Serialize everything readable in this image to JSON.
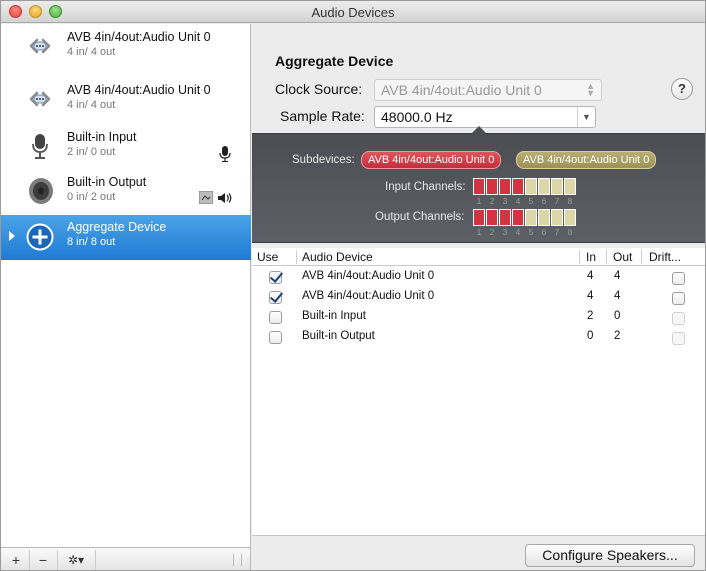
{
  "window": {
    "title": "Audio Devices"
  },
  "sidebar": {
    "devices": [
      {
        "name": "AVB 4in/4out:Audio Unit 0",
        "io": "4 in/ 4 out",
        "icon": "network-icon"
      },
      {
        "name": "AVB 4in/4out:Audio Unit 0",
        "io": "4 in/ 4 out",
        "icon": "network-icon"
      },
      {
        "name": "Built-in Input",
        "io": "2 in/ 0 out",
        "icon": "microphone-icon"
      },
      {
        "name": "Built-in Output",
        "io": "0 in/ 2 out",
        "icon": "speaker-icon"
      },
      {
        "name": "Aggregate Device",
        "io": "8 in/ 8 out",
        "icon": "add-icon",
        "selected": true
      }
    ],
    "footer": {
      "add": "+",
      "remove": "−",
      "gear": "✲▾"
    }
  },
  "detail": {
    "title": "Aggregate Device",
    "clock_source_label": "Clock Source:",
    "clock_source_value": "AVB 4in/4out:Audio Unit 0",
    "sample_rate_label": "Sample Rate:",
    "sample_rate_value": "48000.0 Hz",
    "help": "?"
  },
  "channels": {
    "subdevices_label": "Subdevices:",
    "subdevices": [
      {
        "name": "AVB 4in/4out:Audio Unit 0",
        "color": "#c0303c"
      },
      {
        "name": "AVB 4in/4out:Audio Unit 0",
        "color": "#9c9258"
      }
    ],
    "input_label": "Input Channels:",
    "output_label": "Output Channels:",
    "channel_numbers": [
      "1",
      "2",
      "3",
      "4",
      "5",
      "6",
      "7",
      "8"
    ]
  },
  "table": {
    "headers": {
      "use": "Use",
      "device": "Audio Device",
      "in": "In",
      "out": "Out",
      "drift": "Drift..."
    },
    "rows": [
      {
        "use": true,
        "device": "AVB 4in/4out:Audio Unit 0",
        "in": "4",
        "out": "4",
        "drift": false
      },
      {
        "use": true,
        "device": "AVB 4in/4out:Audio Unit 0",
        "in": "4",
        "out": "4",
        "drift": false
      },
      {
        "use": false,
        "device": "Built-in Input",
        "in": "2",
        "out": "0",
        "drift": false
      },
      {
        "use": false,
        "device": "Built-in Output",
        "in": "0",
        "out": "2",
        "drift": false
      }
    ]
  },
  "buttons": {
    "configure_speakers": "Configure Speakers..."
  }
}
